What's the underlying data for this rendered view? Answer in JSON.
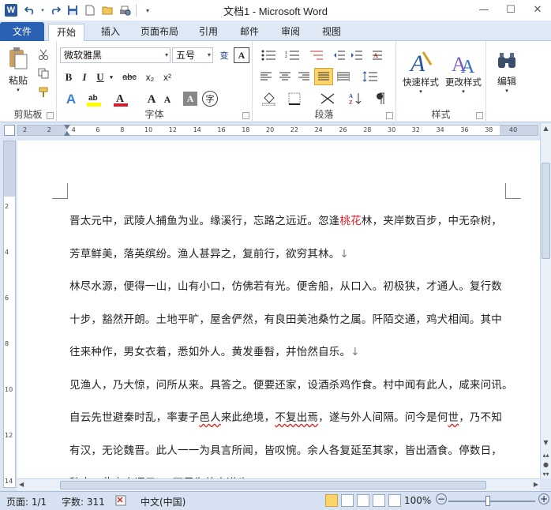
{
  "window": {
    "title": "文档1 - Microsoft Word",
    "app_icon": "W",
    "qat_icons": [
      "undo-icon",
      "redo-icon",
      "save-icon",
      "new-document-icon",
      "open-folder-icon",
      "print-preview-icon",
      "customize-dropdown-icon"
    ]
  },
  "tabs": [
    "文件",
    "开始",
    "插入",
    "页面布局",
    "引用",
    "邮件",
    "审阅",
    "视图"
  ],
  "ribbon": {
    "clipboard": {
      "paste_label": "粘贴",
      "group_label": "剪贴板"
    },
    "font": {
      "font_name": "微软雅黑",
      "font_size": "五号",
      "group_label": "字体",
      "bold": "B",
      "italic": "I",
      "underline": "U",
      "strike": "abc",
      "subscript": "x₂",
      "superscript": "x²",
      "grow": "A",
      "shrink": "A",
      "clear": "A",
      "phonetic": "wén",
      "enclose": "字",
      "phonetic_char": "变",
      "border_char": "A",
      "char_shading": "A"
    },
    "paragraph": {
      "group_label": "段落"
    },
    "styles": {
      "quick_styles_label": "快速样式",
      "change_styles_label": "更改样式",
      "group_label": "样式"
    },
    "editing": {
      "edit_label": "编辑"
    }
  },
  "ruler": {
    "ticks": [
      "2",
      "2",
      "4",
      "6",
      "8",
      "10",
      "12",
      "14",
      "16",
      "18",
      "20",
      "22",
      "24",
      "26",
      "28",
      "30",
      "32",
      "34",
      "36",
      "38",
      "40"
    ]
  },
  "vruler": {
    "ticks": [
      "2",
      "4",
      "6",
      "8",
      "10",
      "12",
      "14"
    ]
  },
  "document": {
    "lines": [
      {
        "before": "晋太元中，武陵人捕鱼为业。缘溪行，忘路之远近。忽逢",
        "red": "桃花",
        "after": "林，夹岸数百步，中无杂树，",
        "mark": ""
      },
      {
        "before": "芳草鲜美，落英缤纷。渔人甚异之，复前行，欲穷其林。",
        "red": "",
        "after": "",
        "mark": "↓"
      },
      {
        "before": "林尽水源，便得一山，山有小口，仿佛若有光。便舍船，从口入。初极狭，才通人。复行数",
        "red": "",
        "after": "",
        "mark": ""
      },
      {
        "before": "十步，豁然开朗。土地平旷，屋舍俨然，有良田美池桑竹之属。阡陌交通，鸡犬相闻。其中",
        "red": "",
        "after": "",
        "mark": ""
      },
      {
        "before": "往来种作，男女衣着，悉如外人。黄发垂髫，并怡然自乐。",
        "red": "",
        "after": "",
        "mark": "↓"
      },
      {
        "before": "见渔人，乃大惊，问所从来。具答之。便要还家，设酒杀鸡作食。村中闻有此人，咸来问讯。",
        "red": "",
        "after": "",
        "mark": ""
      },
      {
        "before": "自云先世避秦时乱，率妻子",
        "wavy1": "邑人",
        "mid": "来此绝境，",
        "wavy2": "不复出焉",
        "after": "，遂与外人间隔。问今是何",
        "wavy3": "世",
        "tail": "，乃不知"
      },
      {
        "before": "有汉，无论魏晋。此人一一为具言所闻，皆叹惋。余人各复延至其家，皆出酒食。停数日，",
        "red": "",
        "after": "",
        "mark": ""
      },
      {
        "before": "辞去。此中人语云：“不足为外人道也。”",
        "red": "",
        "after": "",
        "mark": ""
      }
    ]
  },
  "status": {
    "page": "页面: 1/1",
    "words": "字数: 311",
    "language": "中文(中国)",
    "zoom": "100%",
    "zoom_out": "−",
    "zoom_in": "+"
  },
  "colors": {
    "accent": "#2a61b5",
    "highlight_red": "#e0192a",
    "ribbon_bg": "#ffffff",
    "frame": "#dce6f4"
  }
}
